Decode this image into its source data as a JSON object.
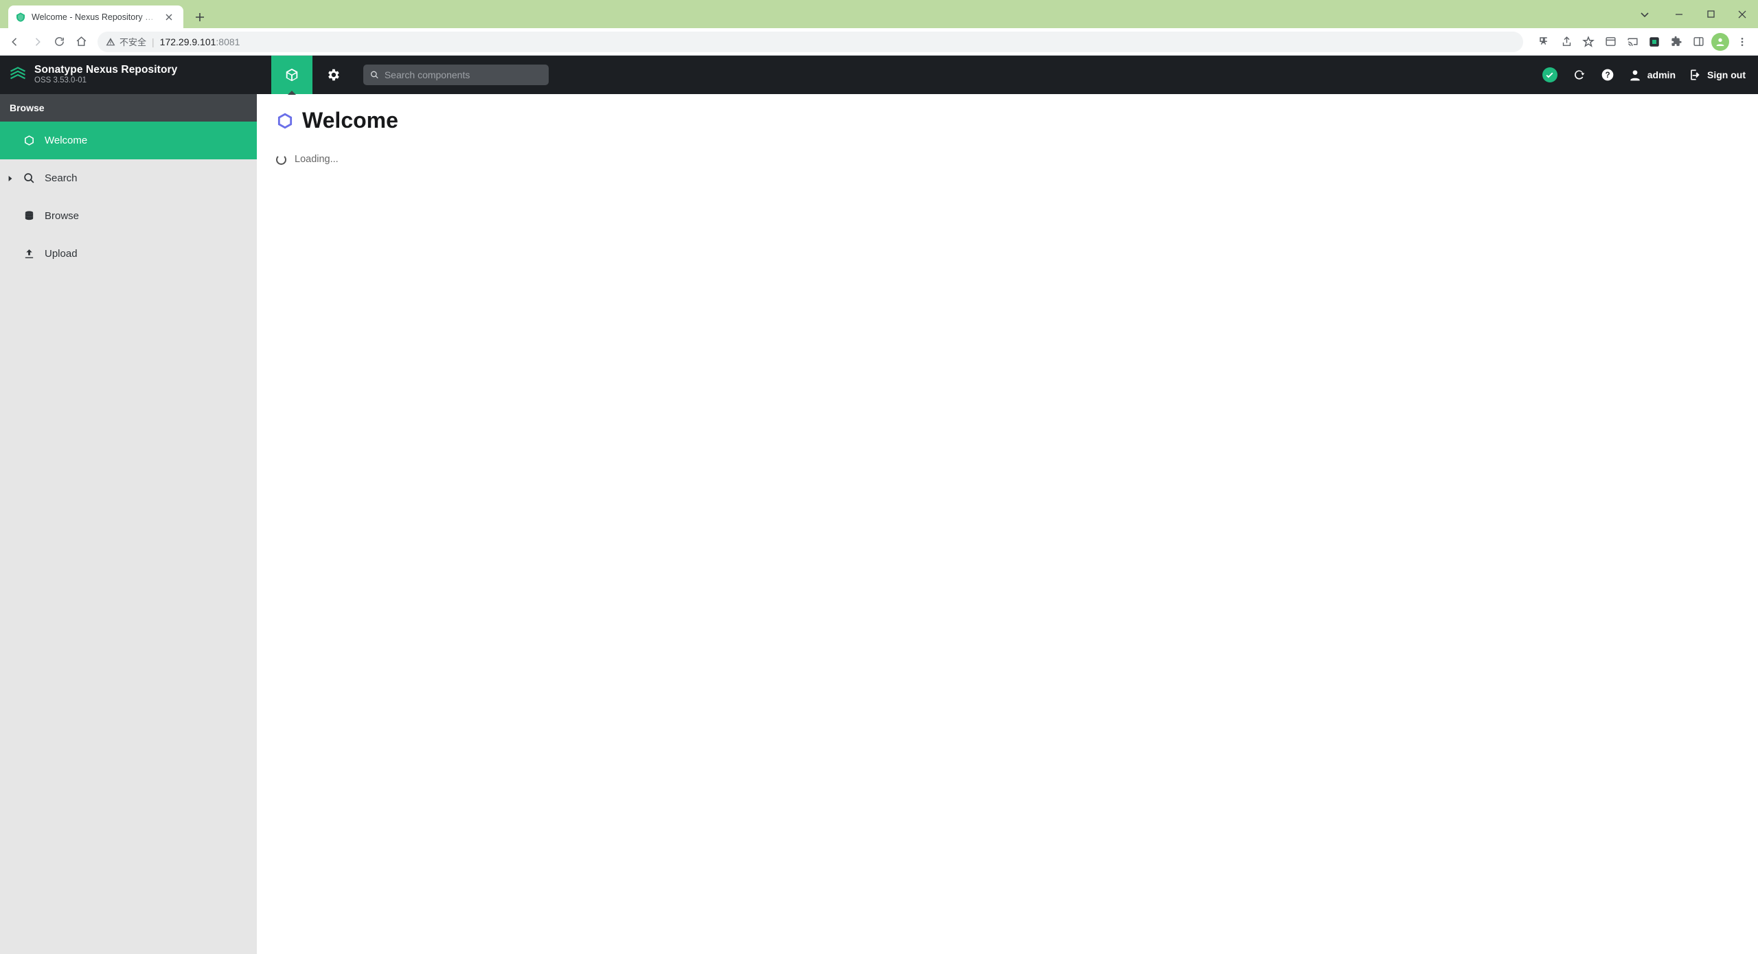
{
  "browser": {
    "tab_title": "Welcome - Nexus Repository Manager",
    "security_label": "不安全",
    "url_host": "172.29.9.101",
    "url_port": ":8081"
  },
  "header": {
    "brand_title": "Sonatype Nexus Repository",
    "brand_sub": "OSS 3.53.0-01",
    "search_placeholder": "Search components",
    "user_label": "admin",
    "signout_label": "Sign out"
  },
  "sidebar": {
    "header": "Browse",
    "items": [
      {
        "label": "Welcome"
      },
      {
        "label": "Search"
      },
      {
        "label": "Browse"
      },
      {
        "label": "Upload"
      }
    ]
  },
  "main": {
    "title": "Welcome",
    "loading_text": "Loading..."
  }
}
